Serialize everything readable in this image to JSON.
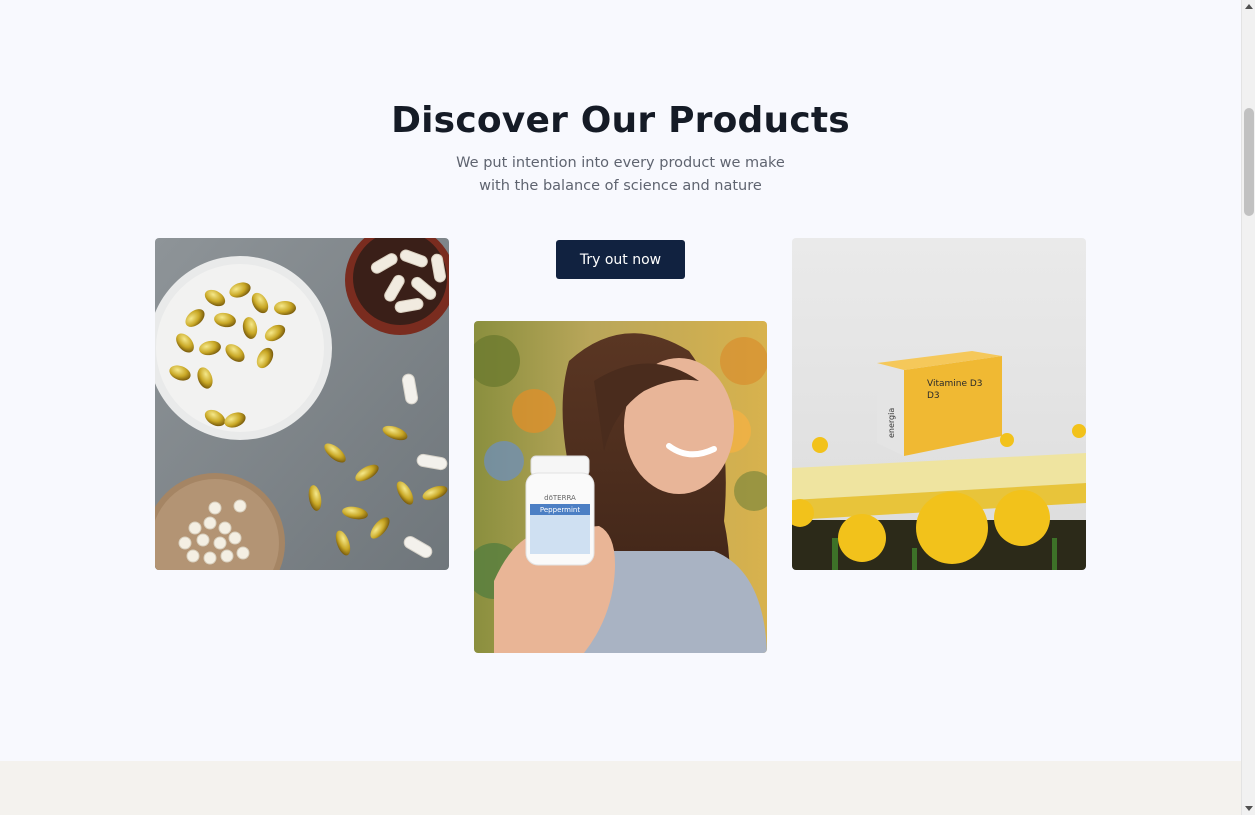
{
  "section": {
    "title": "Discover Our Products",
    "subtitle_line1": "We put intention into every product we make",
    "subtitle_line2": "with the balance of science and nature",
    "cta_label": "Try out now"
  },
  "products": [
    {
      "image": "supplement-capsules-photo"
    },
    {
      "image": "woman-holding-bottle-photo",
      "bottle_brand": "dōTERRA",
      "bottle_label": "Peppermint"
    },
    {
      "image": "vitamin-d3-box-photo",
      "box_title": "Vitamine D3",
      "box_subtitle": "D3",
      "box_brand": "energia"
    }
  ],
  "colors": {
    "background": "#f8f9fe",
    "title": "#151b26",
    "subtitle": "#5f6470",
    "cta_bg": "#112240",
    "cta_text": "#ffffff"
  }
}
